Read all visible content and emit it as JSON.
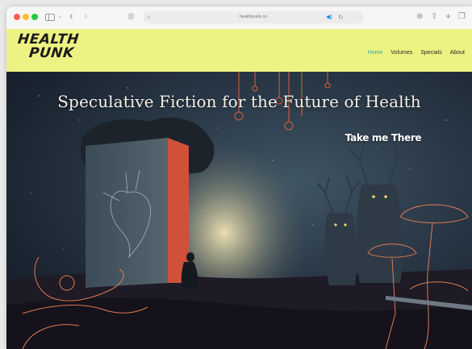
{
  "browser": {
    "url": "healthpunk.co",
    "icons": [
      "sidebar-icon",
      "back-icon",
      "forward-icon",
      "shield-icon",
      "lock-icon",
      "audio-icon",
      "reload-icon",
      "share-icon",
      "new-tab-icon",
      "tabs-icon"
    ]
  },
  "site": {
    "logo_line1": "HEALTH",
    "logo_line2": "PUNK",
    "nav": [
      {
        "label": "Home",
        "active": true
      },
      {
        "label": "Volumes",
        "active": false
      },
      {
        "label": "Specials",
        "active": false
      },
      {
        "label": "About",
        "active": false
      }
    ],
    "colors": {
      "header_bg": "#eef282",
      "nav_active": "#2aa7a0",
      "door": "#d0513a"
    }
  },
  "hero": {
    "title": "Speculative Fiction for the Future of Health",
    "cta": "Take me There"
  }
}
